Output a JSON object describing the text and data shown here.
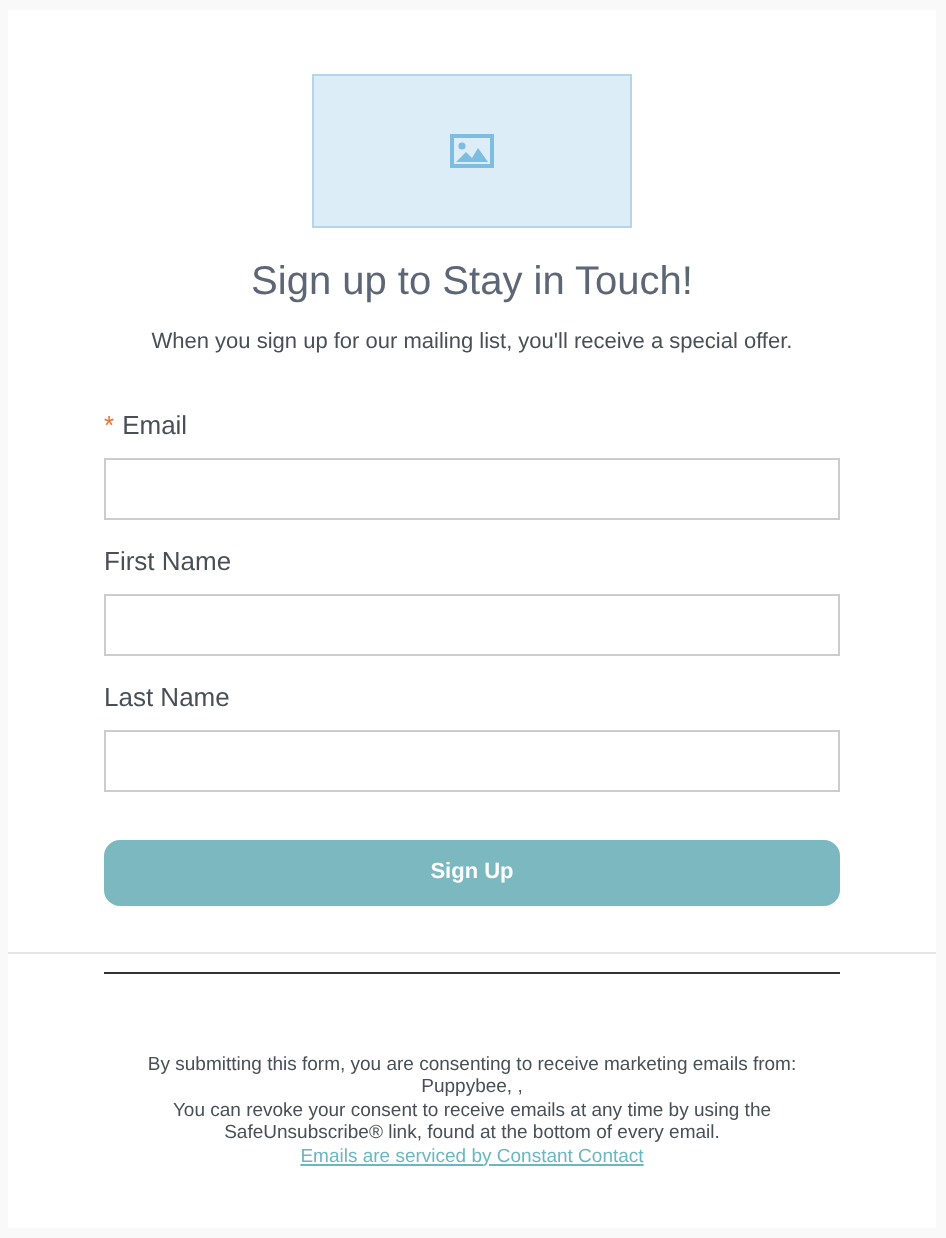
{
  "title": "Sign up to Stay in Touch!",
  "subtitle": "When you sign up for our mailing list, you'll receive a special offer.",
  "fields": [
    {
      "label": "Email",
      "required_marker": "*"
    },
    {
      "label": "First Name"
    },
    {
      "label": "Last Name"
    }
  ],
  "submit_button": "Sign Up",
  "footer": {
    "lines": [
      "By submitting this form, you are consenting to receive marketing emails from:",
      "Puppybee, ,",
      "You can revoke your consent to receive emails at any time by using the SafeUnsubscribe® link, found at the bottom of every email."
    ],
    "link": "Emails are serviced by Constant Contact"
  }
}
